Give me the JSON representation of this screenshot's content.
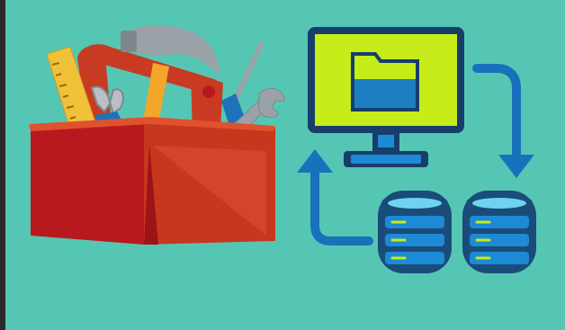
{
  "colors": {
    "background": "#56c6b4",
    "left_strip": "#2b2b2b",
    "toolbox_front": "#b8191e",
    "toolbox_side": "#c8361e",
    "toolbox_panel": "#d2452a",
    "toolbox_handle": "#c93a22",
    "ruler": "#f0c23a",
    "pencil": "#f2a62a",
    "hammer_head": "#9aa2a8",
    "wrench": "#9aa2a8",
    "screwdriver_handle": "#1d73b7",
    "monitor_frame": "#173e6b",
    "monitor_screen": "#c6ec1a",
    "folder_blue": "#1d7ec2",
    "arrow_blue": "#1772bb",
    "database_body": "#1a4c7a",
    "database_band": "#1d8ad6",
    "database_light": "#c6ec1a"
  },
  "icons": [
    "toolbox-icon",
    "hammer-icon",
    "ruler-icon",
    "pliers-icon",
    "screwdriver-icon",
    "wrench-icon",
    "monitor-icon",
    "folder-icon",
    "database-icon",
    "sync-arrow-icon"
  ]
}
